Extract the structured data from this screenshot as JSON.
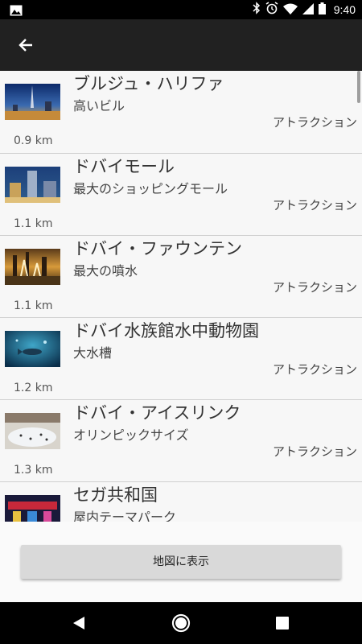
{
  "status_bar": {
    "time": "9:40",
    "icons": [
      "gallery-icon",
      "bluetooth-icon",
      "alarm-icon",
      "wifi-icon",
      "signal-icon",
      "battery-icon"
    ]
  },
  "app_bar": {
    "back_icon": "arrow-back-icon"
  },
  "list": {
    "items": [
      {
        "name": "ブルジュ・ハリファ",
        "description": "高いビル",
        "category": "アトラクション",
        "distance": "0.9 km",
        "thumb": "burj-khalifa"
      },
      {
        "name": "ドバイモール",
        "description": "最大のショッピングモール",
        "category": "アトラクション",
        "distance": "1.1 km",
        "thumb": "dubai-mall"
      },
      {
        "name": "ドバイ・ファウンテン",
        "description": "最大の噴水",
        "category": "アトラクション",
        "distance": "1.1 km",
        "thumb": "dubai-fountain"
      },
      {
        "name": "ドバイ水族館水中動物園",
        "description": "大水槽",
        "category": "アトラクション",
        "distance": "1.2 km",
        "thumb": "aquarium"
      },
      {
        "name": "ドバイ・アイスリンク",
        "description": "オリンピックサイズ",
        "category": "アトラクション",
        "distance": "1.3 km",
        "thumb": "ice-rink"
      },
      {
        "name": "セガ共和国",
        "description": "屋内テーマパーク",
        "category": "",
        "distance": "",
        "thumb": "sega-republic"
      }
    ]
  },
  "map_button": {
    "label": "地図に表示"
  },
  "nav_bar": {
    "icons": [
      "back-triangle-icon",
      "home-circle-icon",
      "recents-square-icon"
    ]
  },
  "colors": {
    "app_bar": "#212121",
    "list_background": "#f7f7f7",
    "button": "#d9d9d9"
  }
}
